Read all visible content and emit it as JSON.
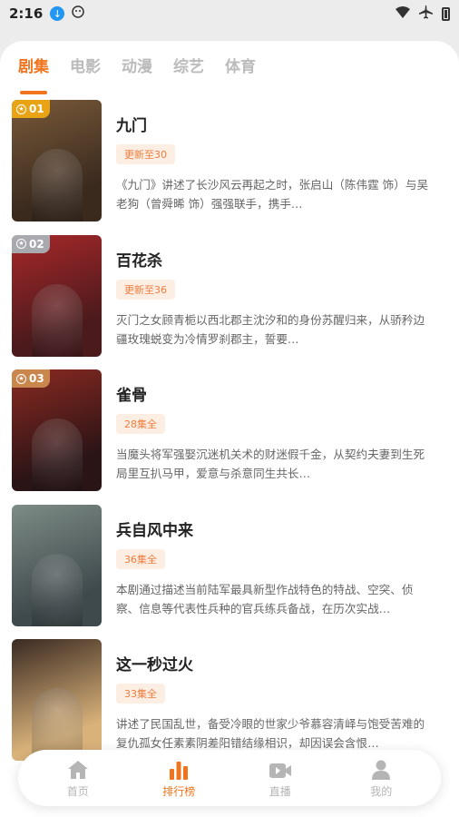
{
  "status_bar": {
    "time": "2:16"
  },
  "tabs": [
    {
      "label": "剧集",
      "active": true
    },
    {
      "label": "电影",
      "active": false
    },
    {
      "label": "动漫",
      "active": false
    },
    {
      "label": "综艺",
      "active": false
    },
    {
      "label": "体育",
      "active": false
    }
  ],
  "items": [
    {
      "rank": "01",
      "title": "九门",
      "tag": "更新至30",
      "description": "《九门》讲述了长沙风云再起之时，张启山（陈伟霆 饰）与吴老狗（曾舜晞 饰）强强联手，携手…",
      "badge_color": "#e8a415",
      "poster_colors": [
        "#3a2a1e",
        "#7a5a3a"
      ]
    },
    {
      "rank": "02",
      "title": "百花杀",
      "tag": "更新至36",
      "description": "灭门之女顾青栀以西北郡主沈汐和的身份苏醒归来，从骄矜边疆玫瑰蜕变为冷情罗刹郡主，誓要…",
      "badge_color": "#a9aab0",
      "poster_colors": [
        "#4a1a1c",
        "#a8282a"
      ]
    },
    {
      "rank": "03",
      "title": "雀骨",
      "tag": "28集全",
      "description": "当魔头将军强娶沉迷机关术的财迷假千金，从契约夫妻到生死局里互扒马甲，爱意与杀意同生共长…",
      "badge_color": "#c9874e",
      "poster_colors": [
        "#2a1416",
        "#8c2a22"
      ]
    },
    {
      "rank": "",
      "title": "兵自风中来",
      "tag": "36集全",
      "description": "本剧通过描述当前陆军最具新型作战特色的特战、空突、侦察、信息等代表性兵种的官兵练兵备战，在历次实战…",
      "badge_color": "",
      "poster_colors": [
        "#3f4a4c",
        "#7d8c86"
      ]
    },
    {
      "rank": "",
      "title": "这一秒过火",
      "tag": "33集全",
      "description": "讲述了民国乱世，备受冷眼的世家少爷慕容清峄与饱受苦难的复仇孤女任素素阴差阳错结缘相识，却因误会含恨…",
      "badge_color": "",
      "poster_colors": [
        "#d9b27a",
        "#3a2a22"
      ]
    }
  ],
  "bottom_nav": [
    {
      "label": "首页",
      "icon": "home-icon",
      "active": false
    },
    {
      "label": "排行榜",
      "icon": "bar-chart-icon",
      "active": true
    },
    {
      "label": "直播",
      "icon": "video-camera-icon",
      "active": false
    },
    {
      "label": "我的",
      "icon": "user-icon",
      "active": false
    }
  ],
  "colors": {
    "accent": "#f0741d",
    "tag_bg": "#fdeee4",
    "tag_text": "#f07c3c"
  }
}
